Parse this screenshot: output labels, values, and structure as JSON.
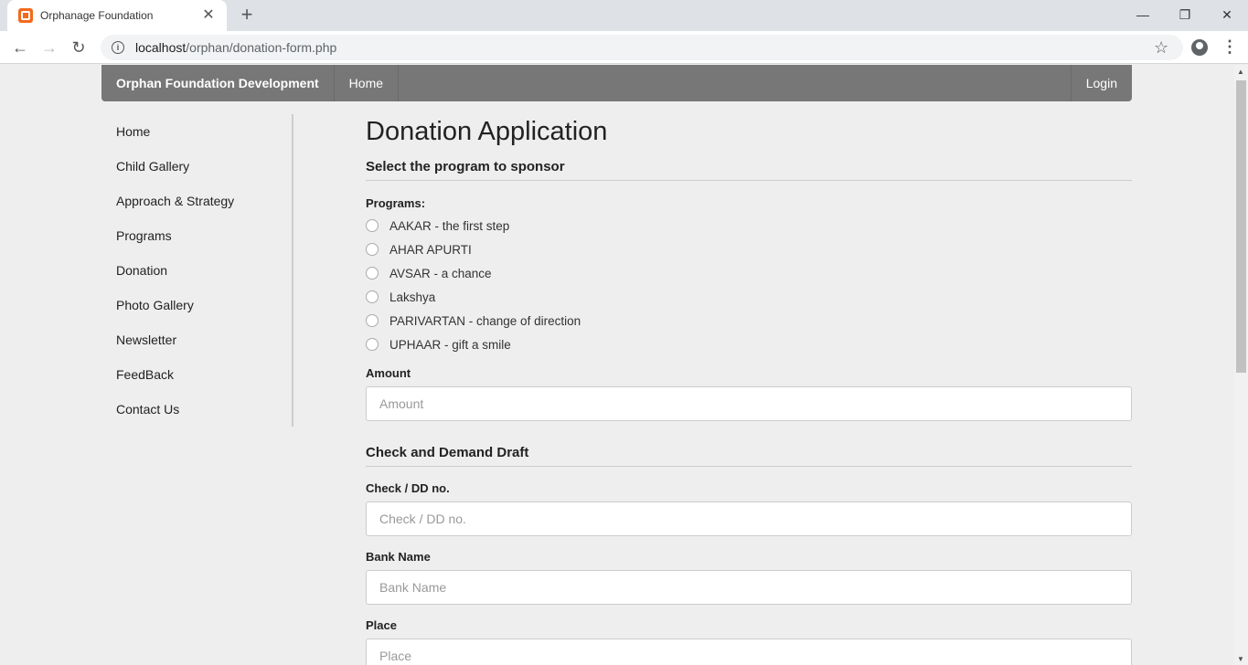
{
  "browser": {
    "tab_title": "Orphanage Foundation",
    "url_host": "localhost",
    "url_path": "/orphan/donation-form.php"
  },
  "navbar": {
    "brand": "Orphan Foundation Development",
    "home": "Home",
    "login": "Login"
  },
  "sidebar": {
    "items": [
      {
        "label": "Home"
      },
      {
        "label": "Child Gallery"
      },
      {
        "label": "Approach & Strategy"
      },
      {
        "label": "Programs"
      },
      {
        "label": "Donation"
      },
      {
        "label": "Photo Gallery"
      },
      {
        "label": "Newsletter"
      },
      {
        "label": "FeedBack"
      },
      {
        "label": "Contact Us"
      }
    ]
  },
  "form": {
    "title": "Donation Application",
    "section_program": "Select the program to sponsor",
    "programs_label": "Programs:",
    "programs": [
      {
        "label": "AAKAR - the first step"
      },
      {
        "label": "AHAR APURTI"
      },
      {
        "label": "AVSAR - a chance"
      },
      {
        "label": "Lakshya"
      },
      {
        "label": "PARIVARTAN - change of direction"
      },
      {
        "label": "UPHAAR - gift a smile"
      }
    ],
    "amount_label": "Amount",
    "amount_placeholder": "Amount",
    "section_check": "Check and Demand Draft",
    "check_label": "Check / DD no.",
    "check_placeholder": "Check / DD no.",
    "bank_label": "Bank Name",
    "bank_placeholder": "Bank Name",
    "place_label": "Place",
    "place_placeholder": "Place"
  }
}
